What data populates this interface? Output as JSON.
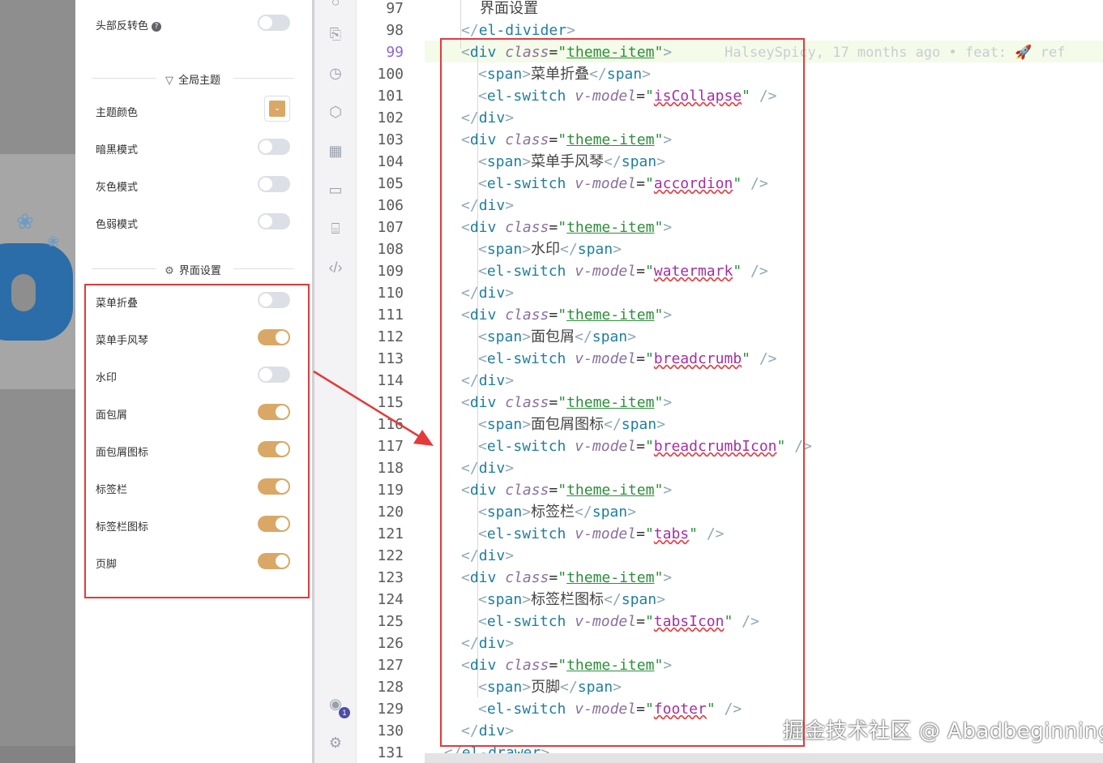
{
  "drawer": {
    "top_row": {
      "label": "头部反转色",
      "on": false
    },
    "global_theme_divider": "全局主题",
    "theme_color_label": "主题颜色",
    "theme_color": "#d9a866",
    "dark_mode_label": "暗黑模式",
    "gray_mode_label": "灰色模式",
    "weak_mode_label": "色弱模式",
    "ui_settings_divider": "界面设置",
    "switches": [
      {
        "label": "菜单折叠",
        "on": false
      },
      {
        "label": "菜单手风琴",
        "on": true
      },
      {
        "label": "水印",
        "on": false
      },
      {
        "label": "面包屑",
        "on": true
      },
      {
        "label": "面包屑图标",
        "on": true
      },
      {
        "label": "标签栏",
        "on": true
      },
      {
        "label": "标签栏图标",
        "on": true
      },
      {
        "label": "页脚",
        "on": true
      }
    ]
  },
  "editor": {
    "line_numbers": [
      "97",
      "98",
      "99",
      "100",
      "101",
      "102",
      "103",
      "104",
      "105",
      "106",
      "107",
      "108",
      "109",
      "110",
      "111",
      "112",
      "113",
      "114",
      "115",
      "116",
      "117",
      "118",
      "119",
      "120",
      "121",
      "122",
      "123",
      "124",
      "125",
      "126",
      "127",
      "128",
      "129",
      "130",
      "131"
    ],
    "active_line": "99",
    "blame": "HalseySpicy, 17 months ago • feat: 🚀 ref",
    "divider_text": "界面设置",
    "divider_close": "</el-divider>",
    "drawer_close": "</el-drawer>",
    "items": [
      {
        "span": "菜单折叠",
        "model": "isCollapse"
      },
      {
        "span": "菜单手风琴",
        "model": "accordion"
      },
      {
        "span": "水印",
        "model": "watermark"
      },
      {
        "span": "面包屑",
        "model": "breadcrumb"
      },
      {
        "span": "面包屑图标",
        "model": "breadcrumbIcon"
      },
      {
        "span": "标签栏",
        "model": "tabs"
      },
      {
        "span": "标签栏图标",
        "model": "tabsIcon"
      },
      {
        "span": "页脚",
        "model": "footer"
      }
    ],
    "class_value": "theme-item"
  },
  "watermark": "掘金技术社区 @ Abadbeginning",
  "colors": {
    "accent": "#d9a866",
    "highlight_box": "#e5393a",
    "active_line_number": "#8f66cf"
  }
}
